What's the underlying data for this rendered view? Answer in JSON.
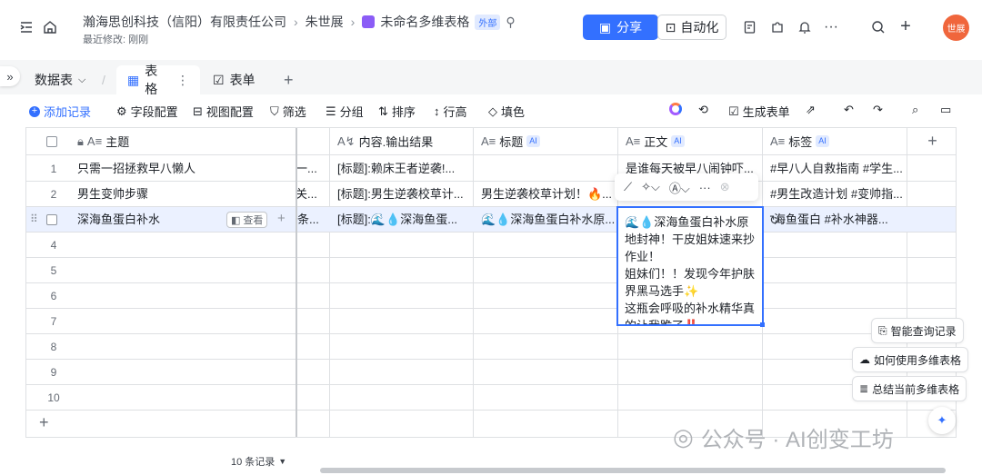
{
  "header": {
    "company": "瀚海思创科技（信阳）有限责任公司",
    "user": "朱世展",
    "doc_title": "未命名多维表格",
    "external_badge": "外部",
    "last_modified": "最近修改: 刚刚",
    "share_label": "分享",
    "automation_label": "自动化",
    "avatar_text": "世展",
    "accent_color": "#3370ff"
  },
  "tabs": {
    "data_table": "数据表",
    "table_view": "表格",
    "form_view": "表单"
  },
  "toolbar": {
    "add_record": "添加记录",
    "field_config": "字段配置",
    "view_config": "视图配置",
    "filter": "筛选",
    "group": "分组",
    "sort": "排序",
    "row_height": "行高",
    "fill": "填色",
    "generate_form": "生成表单"
  },
  "columns": {
    "subject": "主题",
    "content_output": "内容.输出结果",
    "title": "标题",
    "body": "正文",
    "tags": "标签",
    "ai_badge": "AI"
  },
  "rows": [
    {
      "num": "1",
      "subject": "只需一招拯救早八懒人",
      "prev": "一...",
      "content": "[标题]:赖床王者逆袭!...",
      "title": "",
      "body": "是谁每天被早八闹钟吓...",
      "tags": "#早八人自救指南 #学生..."
    },
    {
      "num": "2",
      "subject": "男生变帅步骤",
      "prev": "关...",
      "content": "[标题]:男生逆袭校草计...",
      "title": "男生逆袭校草计划！🔥...",
      "body": "",
      "tags": "#男生改造计划 #变帅指..."
    },
    {
      "num": "3",
      "subject": "深海鱼蛋白补水",
      "prev": "条...",
      "content": "[标题]:🌊💧深海鱼蛋...",
      "title": "🌊💧深海鱼蛋白补水原...",
      "body": "",
      "tags": "海鱼蛋白 #补水神器..."
    }
  ],
  "view_btn": "查看",
  "empty_rows": [
    "4",
    "5",
    "6",
    "7",
    "8",
    "9",
    "10"
  ],
  "editor_text": "🌊💧深海鱼蛋白补水原地封神！干皮姐妹速来抄作业！\n姐妹们！！发现今年护肤界黑马选手✨\n这瓶会呼吸的补水精华真的让我跪了‼️",
  "record_count": "10 条记录",
  "help": {
    "smart_query": "智能查询记录",
    "how_to_use": "如何使用多维表格",
    "summarize": "总结当前多维表格"
  },
  "watermark": "公众号 · AI创变工坊"
}
